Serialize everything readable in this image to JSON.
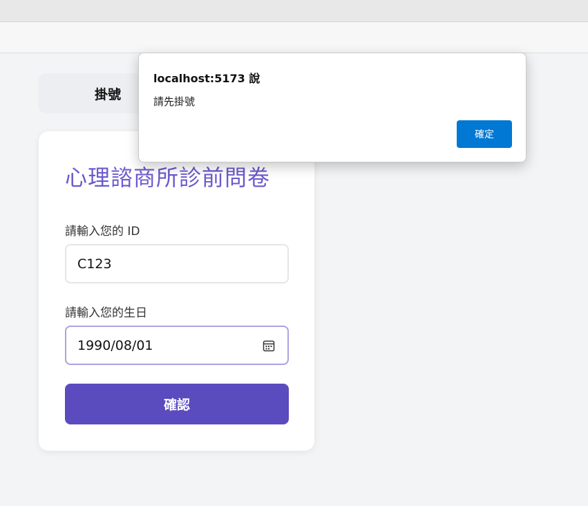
{
  "nav": {
    "tab_label": "掛號"
  },
  "form": {
    "title": "心理諮商所診前問卷",
    "id_label": "請輸入您的 ID",
    "id_value": "C123",
    "birthday_label": "請輸入您的生日",
    "birthday_value": "1990/08/01",
    "confirm_label": "確認",
    "accent_color": "#6a5acd",
    "button_color": "#5a4bbf"
  },
  "alert": {
    "title": "localhost:5173 說",
    "message": "請先掛號",
    "ok_label": "確定",
    "button_color": "#0078d4"
  },
  "icons": {
    "date_picker": "calendar-icon"
  }
}
